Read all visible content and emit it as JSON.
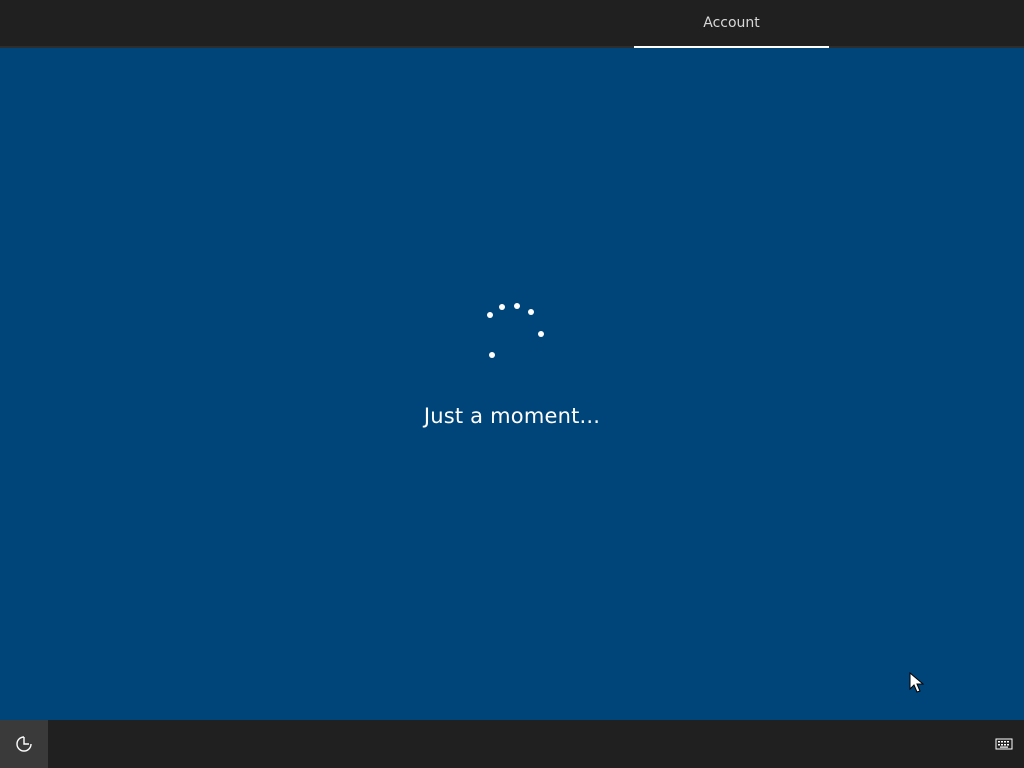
{
  "header": {
    "tabs": [
      {
        "label": "Account",
        "active": true
      }
    ]
  },
  "main": {
    "status_text": "Just a moment...",
    "spinner_icon": "loading-dots-icon"
  },
  "footer": {
    "left_icon": "ease-of-access-icon",
    "right_icon": "keyboard-icon"
  },
  "colors": {
    "background": "#00457a",
    "bars": "#202020",
    "ease_button": "#3a3a3a",
    "text": "#ffffff",
    "tab_text": "#d8d8d8"
  }
}
